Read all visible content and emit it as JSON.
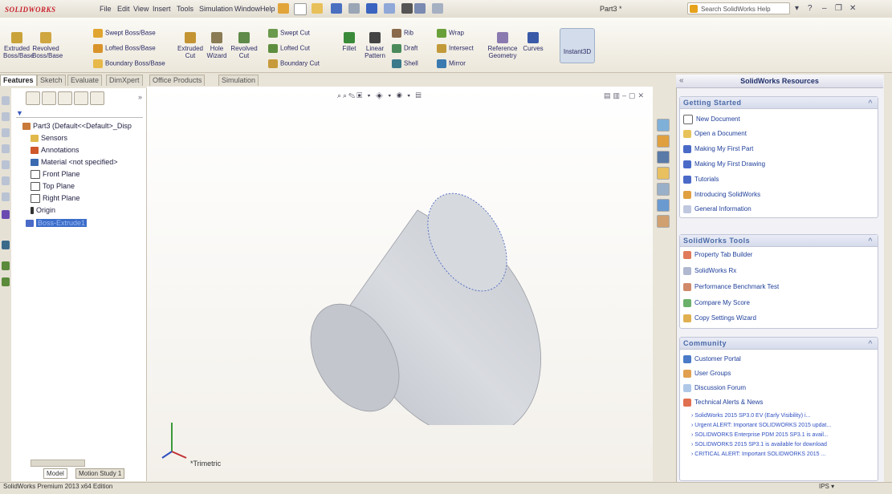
{
  "app": {
    "logo_text": "SOLIDWORKS",
    "document_title": "Part3 *",
    "status_text": "SolidWorks Premium 2013 x64 Edition",
    "units": "IPS"
  },
  "menubar": [
    "File",
    "Edit",
    "View",
    "Insert",
    "Tools",
    "Simulation",
    "Window",
    "Help"
  ],
  "search": {
    "placeholder": "Search SolidWorks Help"
  },
  "commands": {
    "extruded_boss": "Extruded Boss/Base",
    "revolved_boss": "Revolved Boss/Base",
    "swept_boss": "Swept Boss/Base",
    "lofted_boss": "Lofted Boss/Base",
    "boundary_boss": "Boundary Boss/Base",
    "extruded_cut": "Extruded Cut",
    "hole_wizard": "Hole Wizard",
    "revolved_cut": "Revolved Cut",
    "swept_cut": "Swept Cut",
    "lofted_cut": "Lofted Cut",
    "boundary_cut": "Boundary Cut",
    "fillet": "Fillet",
    "linear_pattern": "Linear Pattern",
    "rib": "Rib",
    "draft": "Draft",
    "shell": "Shell",
    "wrap": "Wrap",
    "intersect": "Intersect",
    "mirror": "Mirror",
    "reference_geometry": "Reference Geometry",
    "curves": "Curves",
    "instant3d": "Instant3D"
  },
  "tabs": [
    "Features",
    "Sketch",
    "Evaluate",
    "DimXpert",
    "Office Products",
    "Simulation"
  ],
  "feature_tree": {
    "root": "Part3 (Default<<Default>_Disp",
    "items": [
      "Sensors",
      "Annotations",
      "Material <not specified>",
      "Front Plane",
      "Top Plane",
      "Right Plane",
      "Origin",
      "Boss-Extrude1"
    ]
  },
  "bottom_tabs": [
    "Model",
    "Motion Study 1"
  ],
  "view_label": "*Trimetric",
  "task_pane": {
    "title": "SolidWorks Resources",
    "getting_started": {
      "title": "Getting Started",
      "items": [
        "New Document",
        "Open a Document",
        "Making My First Part",
        "Making My First Drawing",
        "Tutorials",
        "Introducing SolidWorks",
        "General Information"
      ]
    },
    "tools": {
      "title": "SolidWorks Tools",
      "items": [
        "Property Tab Builder",
        "SolidWorks Rx",
        "Performance Benchmark Test",
        "Compare My Score",
        "Copy Settings Wizard"
      ]
    },
    "community": {
      "title": "Community",
      "items": [
        "Customer Portal",
        "User Groups",
        "Discussion Forum",
        "Technical Alerts & News"
      ],
      "news": [
        "SolidWorks 2015 SP3.0 EV (Early Visibility) i...",
        "Urgent ALERT: Important SOLIDWORKS 2015 updat...",
        "SOLIDWORKS Enterprise PDM 2015 SP3.1 is avail...",
        "SOLIDWORKS 2015 SP3.1 is available for download",
        "CRITICAL ALERT: Important SOLIDWORKS 2015 ..."
      ]
    }
  },
  "colors": {
    "accent": "#3b6cc8",
    "brand": "#c8202a"
  }
}
